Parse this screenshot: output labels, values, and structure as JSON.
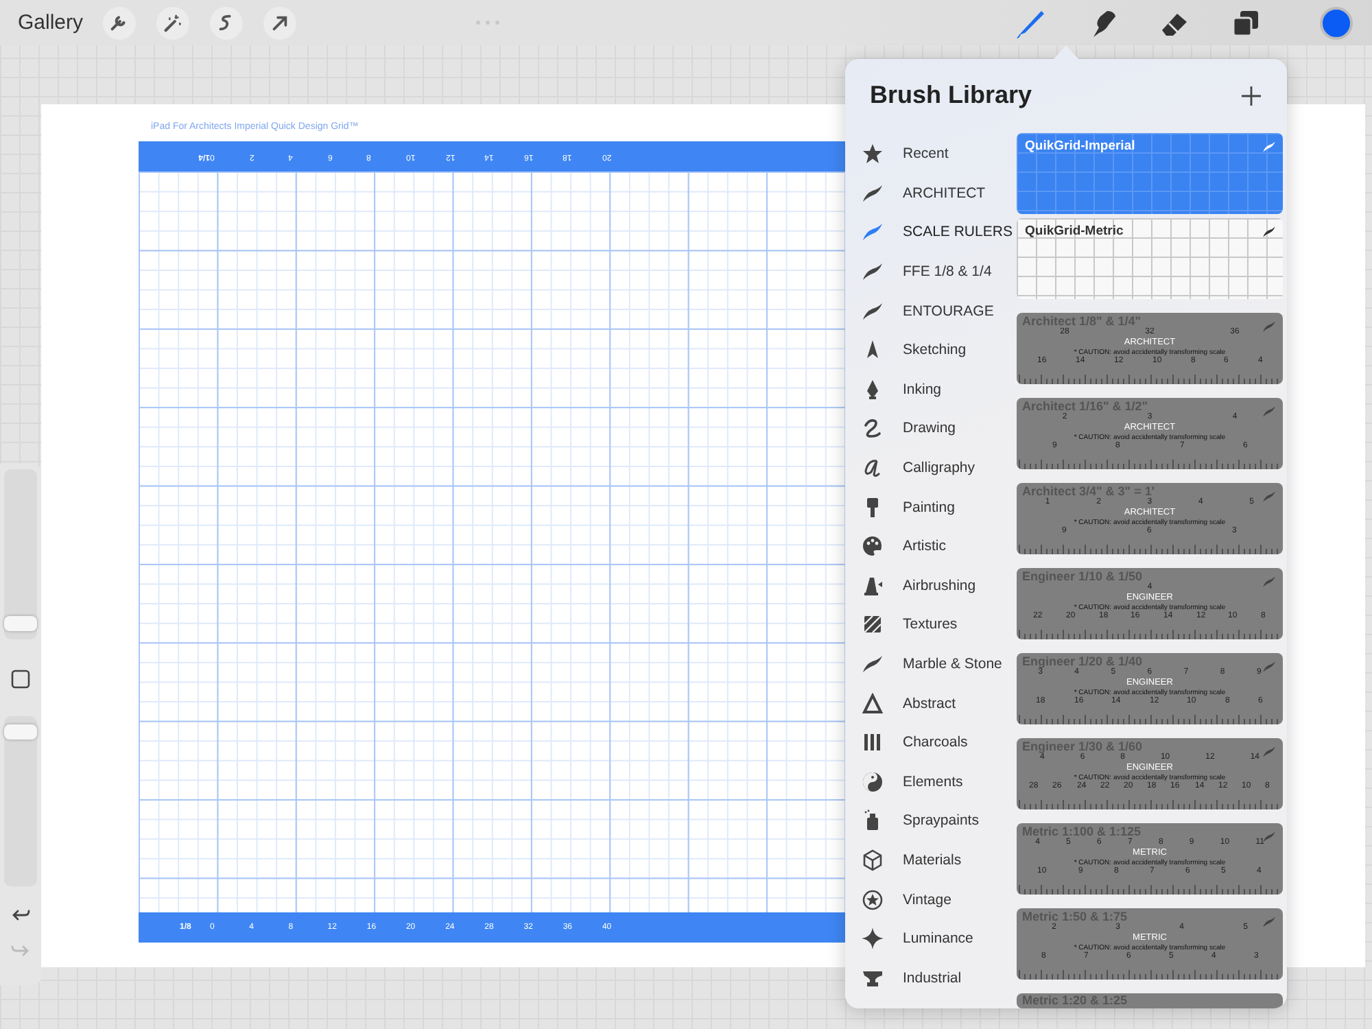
{
  "toolbar": {
    "gallery": "Gallery",
    "left_tools": [
      {
        "kind": "wrench"
      },
      {
        "kind": "wand"
      },
      {
        "kind": "selection"
      },
      {
        "kind": "transform"
      }
    ],
    "right_tools": [
      {
        "kind": "brush",
        "selected": true
      },
      {
        "kind": "smudge",
        "selected": false
      },
      {
        "kind": "eraser",
        "selected": false
      },
      {
        "kind": "layers",
        "selected": false
      }
    ],
    "color": "#0a5cf5"
  },
  "side_bar": {
    "size_slider": {
      "level": 0.05
    },
    "opacity_slider": {
      "level": 0.95
    },
    "undo": {
      "disabled": false
    },
    "redo": {
      "disabled": true
    }
  },
  "canvas": {
    "caption": "iPad For Architects Imperial Quick Design Grid™",
    "top_ruler": {
      "scale": "1/4",
      "numbers": [
        "0",
        "2",
        "4",
        "6",
        "8",
        "10",
        "12",
        "14",
        "16",
        "18",
        "20"
      ]
    },
    "bottom_ruler": {
      "scale": "1/8",
      "numbers": [
        "0",
        "4",
        "8",
        "12",
        "16",
        "20",
        "24",
        "28",
        "32",
        "36",
        "40"
      ]
    }
  },
  "brush_library": {
    "title": "Brush Library",
    "categories": [
      {
        "label": "Recent",
        "selected": false
      },
      {
        "label": "ARCHITECT",
        "selected": false
      },
      {
        "label": "SCALE RULERS",
        "selected": true
      },
      {
        "label": "FFE 1/8 & 1/4",
        "selected": false
      },
      {
        "label": "ENTOURAGE",
        "selected": false
      },
      {
        "label": "Sketching",
        "selected": false
      },
      {
        "label": "Inking",
        "selected": false
      },
      {
        "label": "Drawing",
        "selected": false
      },
      {
        "label": "Calligraphy",
        "selected": false
      },
      {
        "label": "Painting",
        "selected": false
      },
      {
        "label": "Artistic",
        "selected": false
      },
      {
        "label": "Airbrushing",
        "selected": false
      },
      {
        "label": "Textures",
        "selected": false
      },
      {
        "label": "Marble & Stone",
        "selected": false
      },
      {
        "label": "Abstract",
        "selected": false
      },
      {
        "label": "Charcoals",
        "selected": false
      },
      {
        "label": "Elements",
        "selected": false
      },
      {
        "label": "Spraypaints",
        "selected": false
      },
      {
        "label": "Materials",
        "selected": false
      },
      {
        "label": "Vintage",
        "selected": false
      },
      {
        "label": "Luminance",
        "selected": false
      },
      {
        "label": "Industrial",
        "selected": false
      }
    ],
    "brushes": [
      {
        "kind": "grid",
        "name": "QuikGrid-Imperial",
        "selected": true
      },
      {
        "kind": "grid",
        "name": "QuikGrid-Metric",
        "selected": false
      },
      {
        "kind": "ruler",
        "name": "Architect 1/8\" & 1/4\"",
        "tag": "ARCHITECT",
        "caution": "* CAUTION: avoid accidentally transforming scale",
        "top_numbers": [
          "28",
          "32",
          "36"
        ],
        "bottom_numbers": [
          "16",
          "14",
          "12",
          "10",
          "8",
          "6",
          "4"
        ]
      },
      {
        "kind": "ruler",
        "name": "Architect 1/16\" & 1/2\"",
        "tag": "ARCHITECT",
        "caution": "* CAUTION: avoid accidentally transforming scale",
        "top_numbers": [
          "2",
          "3",
          "4"
        ],
        "bottom_numbers": [
          "9",
          "8",
          "7",
          "6"
        ]
      },
      {
        "kind": "ruler",
        "name": "Architect 3/4\" & 3\" = 1'",
        "tag": "ARCHITECT",
        "caution": "* CAUTION: avoid accidentally transforming scale",
        "top_numbers": [
          "1",
          "2",
          "3",
          "4",
          "5"
        ],
        "bottom_numbers": [
          "9",
          "6",
          "3"
        ]
      },
      {
        "kind": "ruler",
        "name": "Engineer 1/10 & 1/50",
        "tag": "ENGINEER",
        "caution": "* CAUTION: avoid accidentally transforming scale",
        "top_numbers": [
          "4"
        ],
        "bottom_numbers": [
          "22",
          "20",
          "18",
          "16",
          "14",
          "12",
          "10",
          "8"
        ]
      },
      {
        "kind": "ruler",
        "name": "Engineer 1/20 & 1/40",
        "tag": "ENGINEER",
        "caution": "* CAUTION: avoid accidentally transforming scale",
        "top_numbers": [
          "3",
          "4",
          "5",
          "6",
          "7",
          "8",
          "9"
        ],
        "bottom_numbers": [
          "18",
          "16",
          "14",
          "12",
          "10",
          "8",
          "6"
        ]
      },
      {
        "kind": "ruler",
        "name": "Engineer 1/30 & 1/60",
        "tag": "ENGINEER",
        "caution": "* CAUTION: avoid accidentally transforming scale",
        "top_numbers": [
          "4",
          "6",
          "8",
          "10",
          "12",
          "14"
        ],
        "bottom_numbers": [
          "28",
          "26",
          "24",
          "22",
          "20",
          "18",
          "16",
          "14",
          "12",
          "10",
          "8"
        ]
      },
      {
        "kind": "ruler",
        "name": "Metric 1:100 & 1:125",
        "tag": "METRIC",
        "caution": "* CAUTION: avoid accidentally transforming scale",
        "top_numbers": [
          "4",
          "5",
          "6",
          "7",
          "8",
          "9",
          "10",
          "11"
        ],
        "bottom_numbers": [
          "10",
          "9",
          "8",
          "7",
          "6",
          "5",
          "4"
        ]
      },
      {
        "kind": "ruler",
        "name": "Metric 1:50 & 1:75",
        "tag": "METRIC",
        "caution": "* CAUTION: avoid accidentally transforming scale",
        "top_numbers": [
          "2",
          "3",
          "4",
          "5"
        ],
        "bottom_numbers": [
          "8",
          "7",
          "6",
          "5",
          "4",
          "3"
        ]
      },
      {
        "kind": "ruler_cut",
        "name": "Metric 1:20 & 1:25"
      }
    ]
  }
}
